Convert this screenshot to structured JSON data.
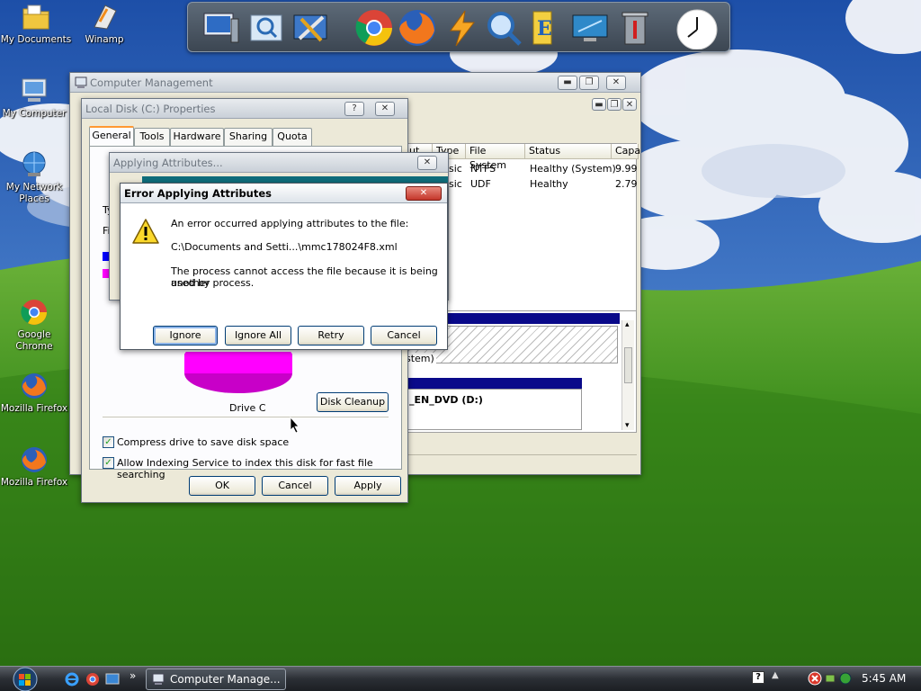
{
  "desktop": {
    "icons": [
      {
        "label": "My Documents"
      },
      {
        "label": "Winamp"
      },
      {
        "label": "My Computer"
      },
      {
        "label": "My Network Places"
      },
      {
        "label": "Google Chrome"
      },
      {
        "label": "Mozilla Firefox"
      },
      {
        "label": "Mozilla Firefox"
      }
    ]
  },
  "dock": {
    "items": [
      "computer-icon",
      "search-folder-icon",
      "tools-icon",
      "chrome-icon",
      "firefox-icon",
      "lightning-icon",
      "magnifier-icon",
      "folder-icon",
      "monitor-icon",
      "trash-icon",
      "clock-icon"
    ]
  },
  "computer_management": {
    "title": "Computer Management",
    "columns": [
      "ut",
      "Type",
      "File System",
      "Status",
      "Capa"
    ],
    "rows": [
      {
        "type": "sic",
        "fs": "NTFS",
        "status": "Healthy (System)",
        "cap": "9.99"
      },
      {
        "type": "sic",
        "fs": "UDF",
        "status": "Healthy",
        "cap": "2.79"
      }
    ],
    "disk_partition_label": "stem)",
    "cdrom_label": "_EN_DVD  (D:)"
  },
  "properties": {
    "title": "Local Disk (C:) Properties",
    "help_glyph": "?",
    "tabs": [
      "General",
      "Tools",
      "Hardware",
      "Sharing",
      "Quota"
    ],
    "partial_labels": [
      "Ty",
      "Fi"
    ],
    "drive_label": "Drive C",
    "disk_cleanup": "Disk Cleanup",
    "compress_label": "Compress drive to save disk space",
    "index_label": "Allow Indexing Service to index this disk for fast file searching",
    "ok": "OK",
    "cancel": "Cancel",
    "apply": "Apply"
  },
  "applying": {
    "title": "Applying Attributes..."
  },
  "error_dialog": {
    "title": "Error Applying Attributes",
    "line1": "An error occurred applying attributes to the file:",
    "path": "C:\\Documents and Setti...\\mmc178024F8.xml",
    "line3a": "The process cannot access the file because it is being used by",
    "line3b": "another process.",
    "buttons": {
      "ignore": "Ignore",
      "ignore_all": "Ignore All",
      "retry": "Retry",
      "cancel": "Cancel"
    }
  },
  "taskbar": {
    "task_label": "Computer Manage...",
    "chevron": "»",
    "clock": "5:45 AM"
  },
  "colors": {
    "accent": "#0a246a",
    "error_red": "#d9382b",
    "pie_free": "#ff00ff",
    "pie_used": "#0000ff"
  }
}
